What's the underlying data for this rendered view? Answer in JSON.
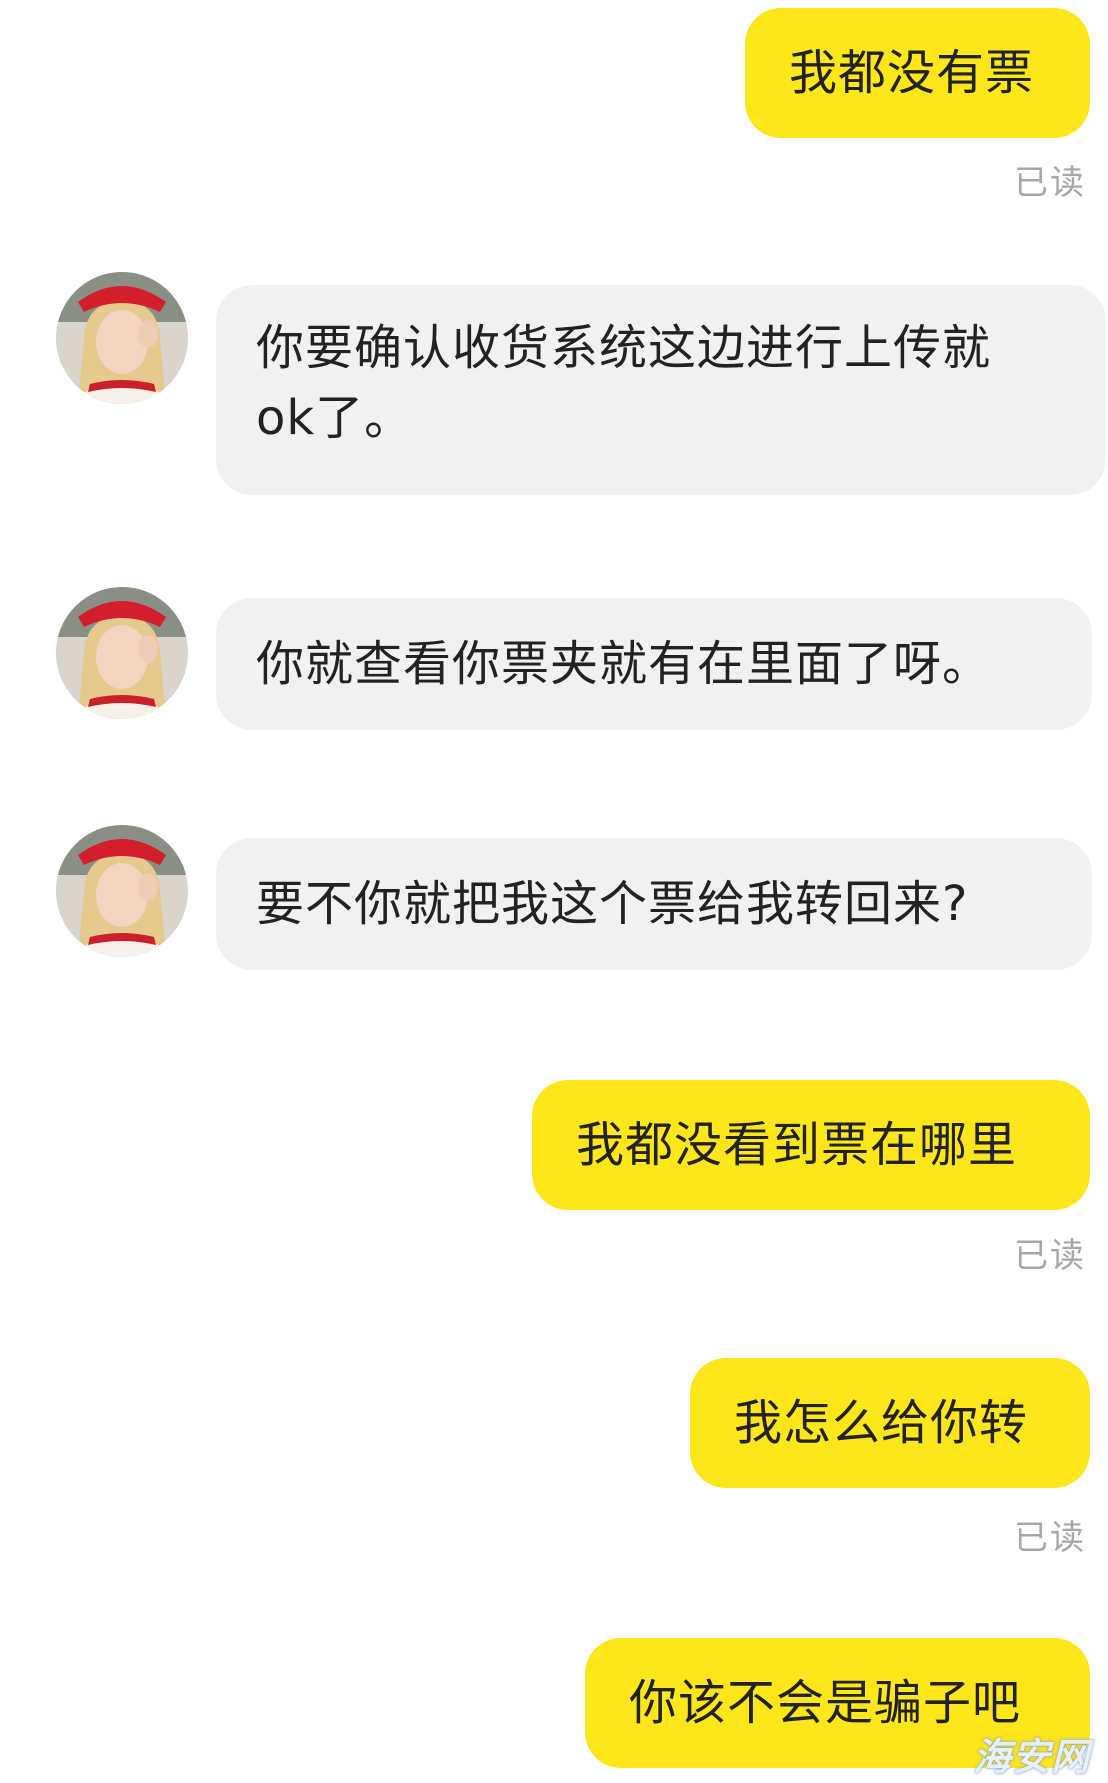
{
  "colors": {
    "outgoing_bubble": "#fde61a",
    "incoming_bubble": "#f1f1f1",
    "read_receipt": "#a7a7a7",
    "text": "#222222"
  },
  "messages": [
    {
      "direction": "outgoing",
      "text": "我都没有票",
      "status": "已读"
    },
    {
      "direction": "incoming",
      "avatar": "contact-avatar",
      "lines": [
        "你要确认收货系统这边进行上传就",
        "ok了。"
      ]
    },
    {
      "direction": "incoming",
      "avatar": "contact-avatar",
      "text": "你就查看你票夹就有在里面了呀。"
    },
    {
      "direction": "incoming",
      "avatar": "contact-avatar",
      "text": "要不你就把我这个票给我转回来?"
    },
    {
      "direction": "outgoing",
      "text": "我都没看到票在哪里",
      "status": "已读"
    },
    {
      "direction": "outgoing",
      "text": "我怎么给你转",
      "status": "已读"
    },
    {
      "direction": "outgoing",
      "text": "你该不会是骗子吧"
    }
  ],
  "watermark": "海安网"
}
